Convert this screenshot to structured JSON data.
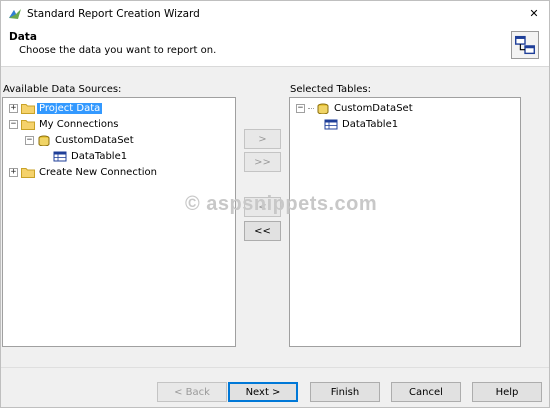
{
  "window": {
    "title": "Standard Report Creation Wizard",
    "close_glyph": "✕"
  },
  "header": {
    "title": "Data",
    "subtitle": "Choose the data you want to report on.",
    "icon": "table-link-icon"
  },
  "available": {
    "label": "Available Data Sources:",
    "items": [
      {
        "label": "Project Data",
        "icon": "folder-icon",
        "expander": "+",
        "selected": true
      },
      {
        "label": "My Connections",
        "icon": "folder-icon",
        "expander": "−",
        "selected": false
      },
      {
        "label": "CustomDataSet",
        "icon": "dataset-icon",
        "expander": "−",
        "selected": false
      },
      {
        "label": "DataTable1",
        "icon": "table-icon",
        "expander": "",
        "selected": false
      },
      {
        "label": "Create New Connection",
        "icon": "folder-icon",
        "expander": "+",
        "selected": false
      }
    ]
  },
  "selected": {
    "label": "Selected Tables:",
    "items": [
      {
        "label": "CustomDataSet",
        "icon": "dataset-icon",
        "expander": "−"
      },
      {
        "label": "DataTable1",
        "icon": "table-icon",
        "expander": ""
      }
    ]
  },
  "transfer": {
    "add_one": ">",
    "add_all": ">>",
    "remove_one": "<",
    "remove_all": "<<"
  },
  "watermark": "© aspsnippets.com",
  "footer": {
    "back": "< Back",
    "next": "Next >",
    "finish": "Finish",
    "cancel": "Cancel",
    "help": "Help"
  },
  "colors": {
    "selection": "#3399ff",
    "default_button_border": "#0078d7"
  }
}
